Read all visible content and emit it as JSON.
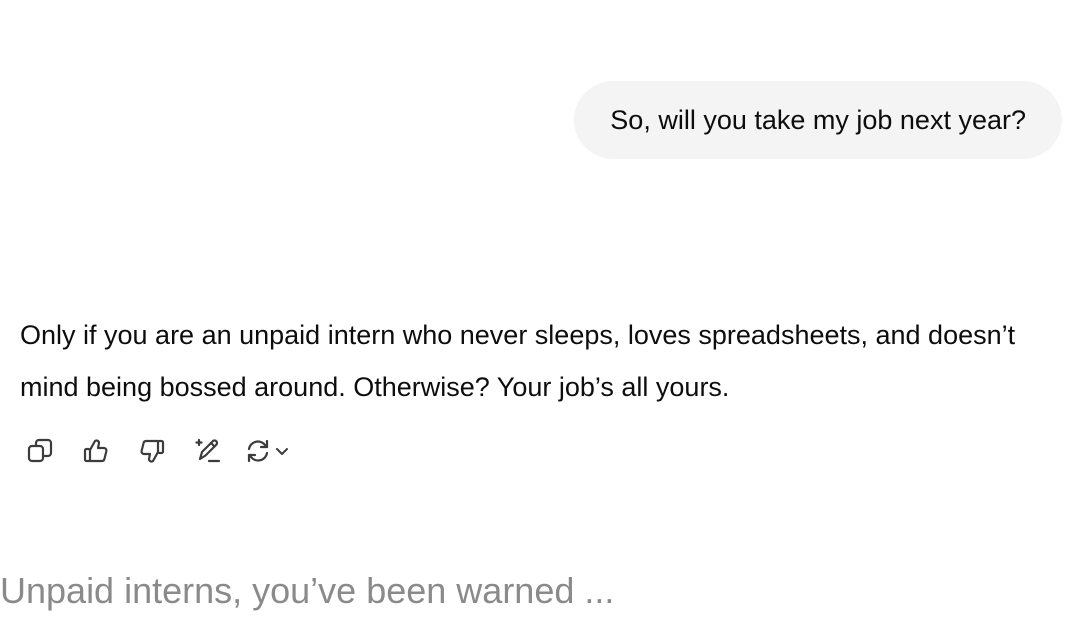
{
  "conversation": {
    "user_message": "So, will you take my job next year?",
    "assistant_message": "Only if you are an unpaid intern who never sleeps, loves spreadsheets, and doesn’t mind being bossed around. Otherwise? Your job’s all yours."
  },
  "actions": [
    {
      "icon": "copy-icon"
    },
    {
      "icon": "thumbs-up-icon"
    },
    {
      "icon": "thumbs-down-icon"
    },
    {
      "icon": "edit-sparkle-icon"
    },
    {
      "icon": "regenerate-icon"
    },
    {
      "icon": "chevron-down-icon"
    }
  ],
  "caption": "Unpaid interns, you’ve been warned ..."
}
